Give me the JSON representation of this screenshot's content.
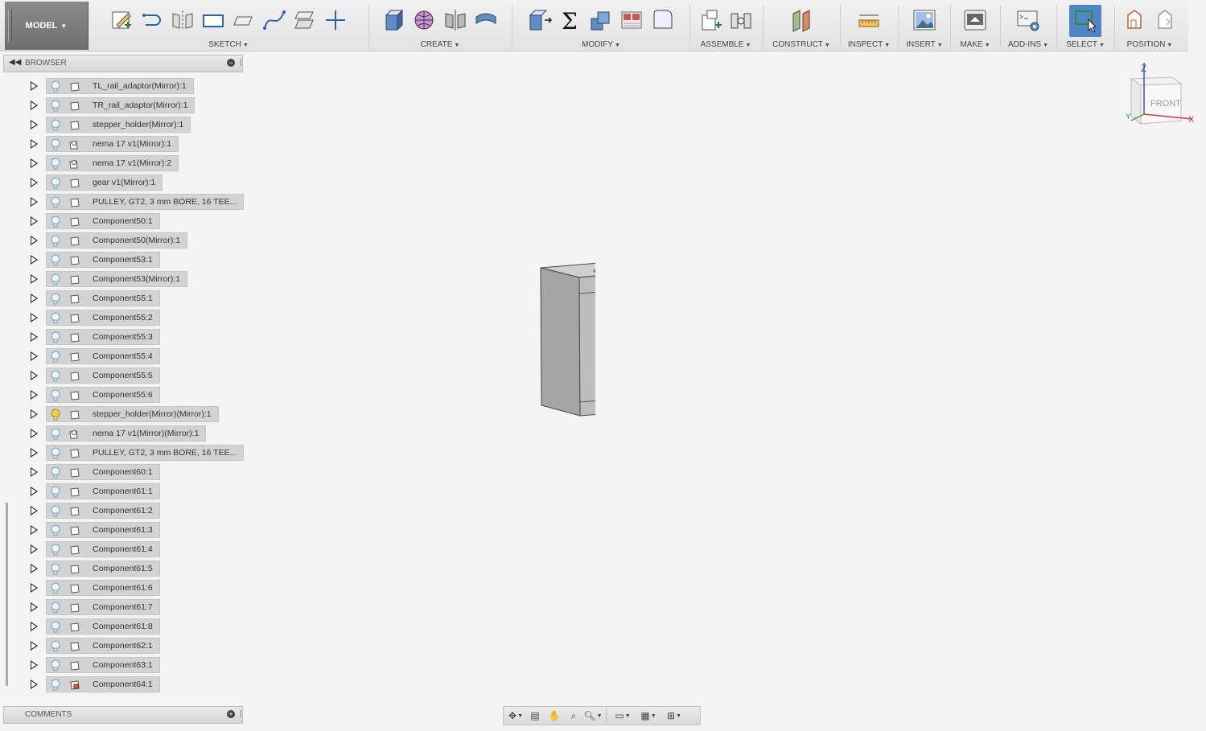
{
  "toolbar": {
    "mode": "MODEL",
    "groups": [
      {
        "label": "SKETCH"
      },
      {
        "label": "CREATE"
      },
      {
        "label": "MODIFY"
      },
      {
        "label": "ASSEMBLE"
      },
      {
        "label": "CONSTRUCT"
      },
      {
        "label": "INSPECT"
      },
      {
        "label": "INSERT"
      },
      {
        "label": "MAKE"
      },
      {
        "label": "ADD-INS"
      },
      {
        "label": "SELECT"
      },
      {
        "label": "POSITION"
      }
    ]
  },
  "browser": {
    "title": "BROWSER",
    "items": [
      {
        "label": "TL_rail_adaptor(Mirror):1",
        "visible": true,
        "type": "component"
      },
      {
        "label": "TR_rail_adaptor(Mirror):1",
        "visible": true,
        "type": "component"
      },
      {
        "label": "stepper_holder(Mirror):1",
        "visible": true,
        "type": "component"
      },
      {
        "label": "nema 17 v1(Mirror):1",
        "visible": true,
        "type": "linked"
      },
      {
        "label": "nema 17 v1(Mirror):2",
        "visible": true,
        "type": "linked"
      },
      {
        "label": "gear v1(Mirror):1",
        "visible": true,
        "type": "component"
      },
      {
        "label": "PULLEY, GT2, 3 mm BORE,  16 TEE...",
        "visible": true,
        "type": "component"
      },
      {
        "label": "Component50:1",
        "visible": true,
        "type": "component"
      },
      {
        "label": "Component50(Mirror):1",
        "visible": true,
        "type": "component"
      },
      {
        "label": "Component53:1",
        "visible": true,
        "type": "component"
      },
      {
        "label": "Component53(Mirror):1",
        "visible": true,
        "type": "component"
      },
      {
        "label": "Component55:1",
        "visible": true,
        "type": "component"
      },
      {
        "label": "Component55:2",
        "visible": true,
        "type": "component"
      },
      {
        "label": "Component55:3",
        "visible": true,
        "type": "component"
      },
      {
        "label": "Component55:4",
        "visible": true,
        "type": "component"
      },
      {
        "label": "Component55:5",
        "visible": true,
        "type": "component"
      },
      {
        "label": "Component55:6",
        "visible": true,
        "type": "component"
      },
      {
        "label": "stepper_holder(Mirror)(Mirror):1",
        "visible": true,
        "type": "component",
        "highlight": true
      },
      {
        "label": "nema 17 v1(Mirror)(Mirror):1",
        "visible": true,
        "type": "linked"
      },
      {
        "label": "PULLEY, GT2, 3 mm BORE,  16 TEE...",
        "visible": true,
        "type": "component"
      },
      {
        "label": "Component60:1",
        "visible": true,
        "type": "component"
      },
      {
        "label": "Component61:1",
        "visible": true,
        "type": "component"
      },
      {
        "label": "Component61:2",
        "visible": true,
        "type": "component"
      },
      {
        "label": "Component61:3",
        "visible": true,
        "type": "component"
      },
      {
        "label": "Component61:4",
        "visible": true,
        "type": "component"
      },
      {
        "label": "Component61:5",
        "visible": true,
        "type": "component"
      },
      {
        "label": "Component61:6",
        "visible": true,
        "type": "component"
      },
      {
        "label": "Component61:7",
        "visible": true,
        "type": "component"
      },
      {
        "label": "Component61:8",
        "visible": true,
        "type": "component"
      },
      {
        "label": "Component62:1",
        "visible": true,
        "type": "component"
      },
      {
        "label": "Component63:1",
        "visible": true,
        "type": "component"
      },
      {
        "label": "Component64:1",
        "visible": true,
        "type": "active"
      }
    ]
  },
  "comments": {
    "title": "COMMENTS"
  },
  "viewcube": {
    "face": "FRONT",
    "axis_x": "X",
    "axis_z": "Z",
    "axis_y": "Y"
  },
  "colors": {
    "select_active": "#4f86c6",
    "bulb_on": "#f0d24a",
    "bulb_off": "#9ec3d8"
  }
}
